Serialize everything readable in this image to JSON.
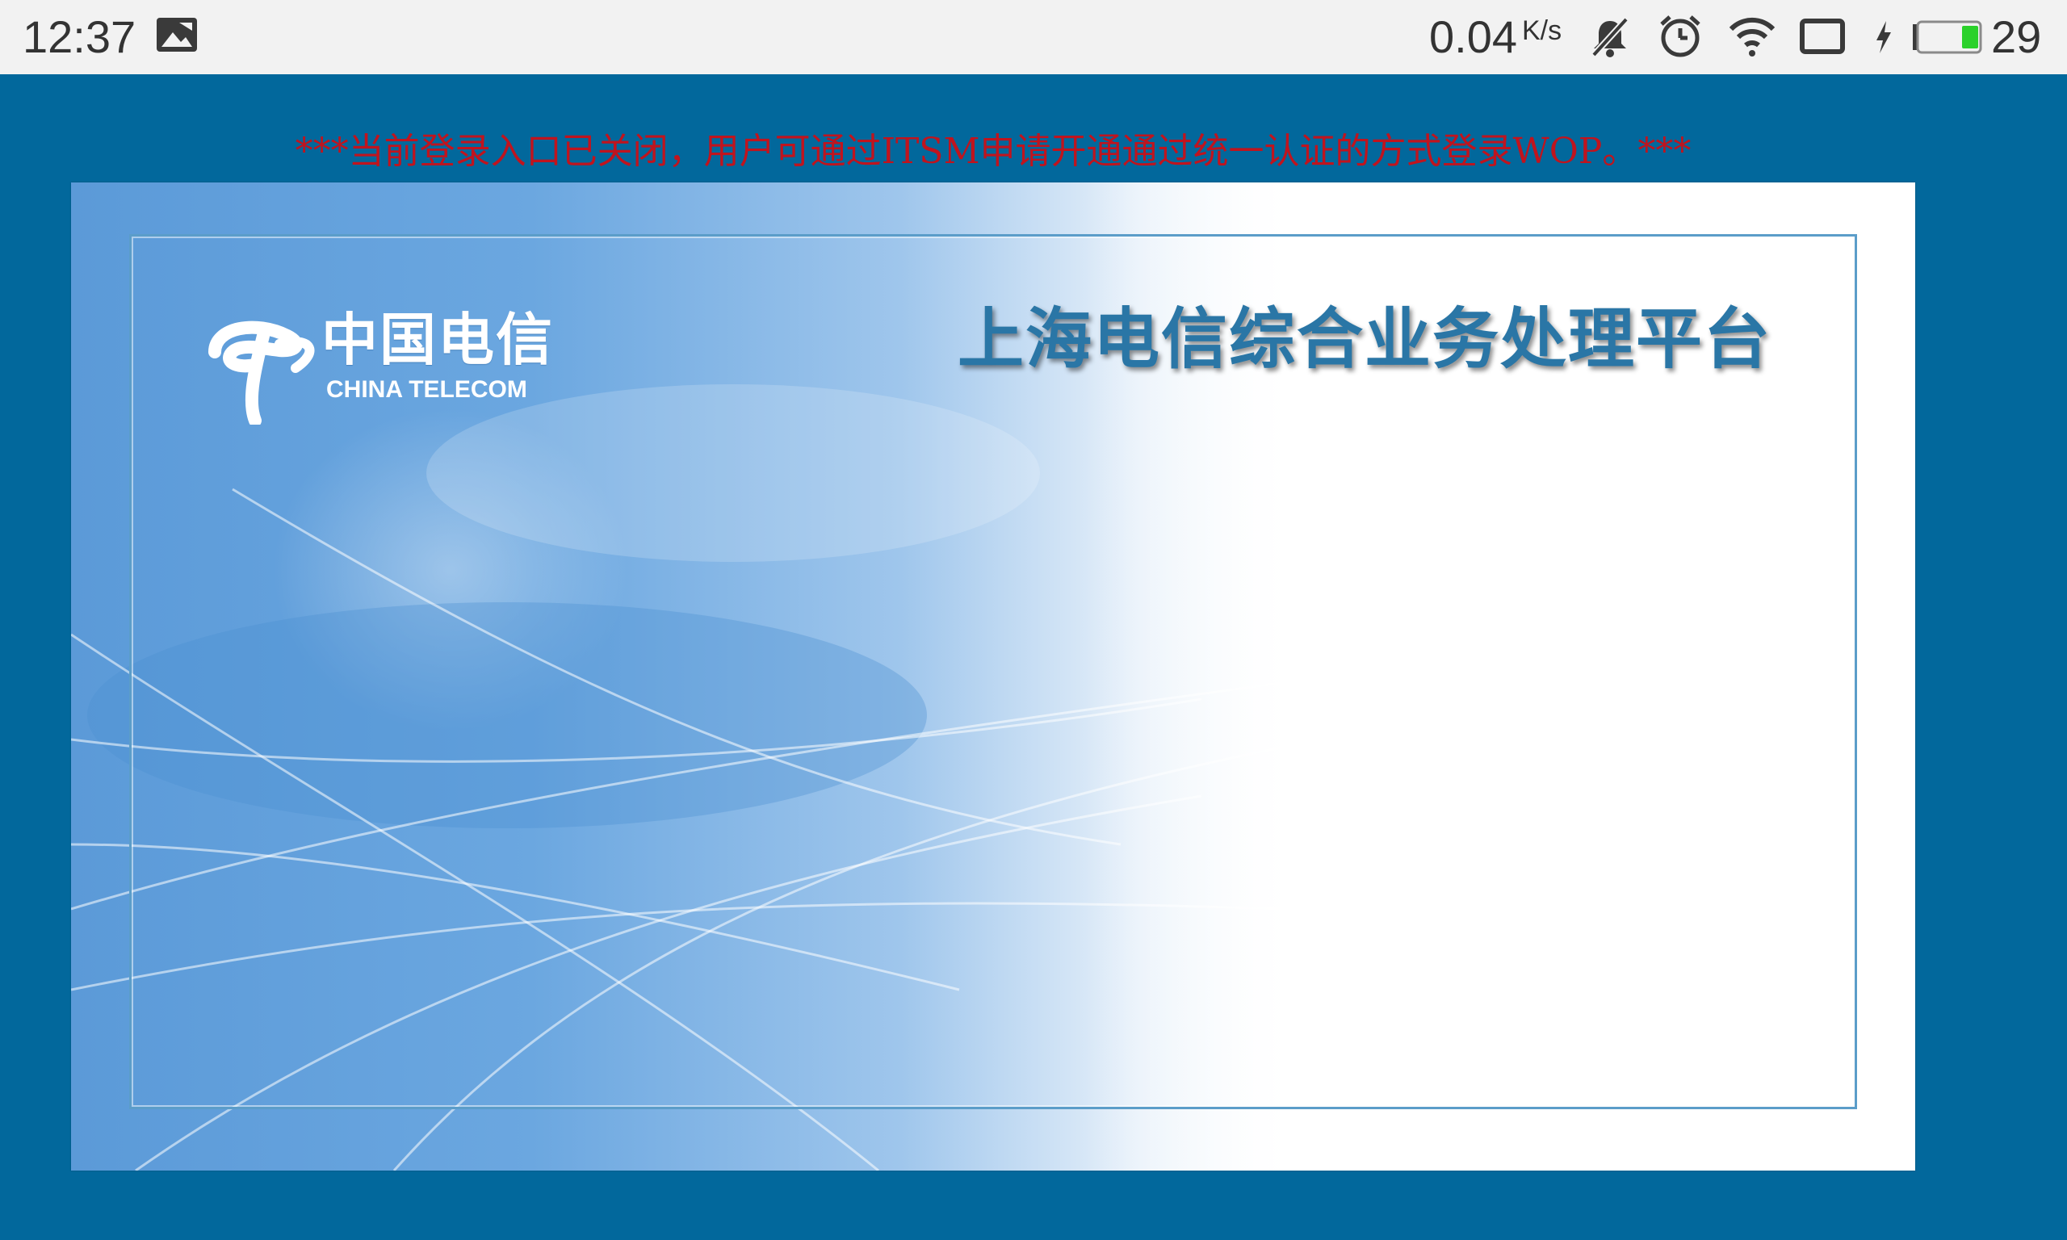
{
  "status_bar": {
    "time": "12:37",
    "net_speed_value": "0.04",
    "net_speed_unit": "K/s",
    "battery_level": "29",
    "icons": [
      "image-notification-icon",
      "mute-icon",
      "alarm-icon",
      "wifi-icon",
      "screen-rotation-icon",
      "charging-icon",
      "battery-icon"
    ],
    "battery_fill_color": "#2bd12b"
  },
  "notice": {
    "text": "***当前登录入口已关闭，用户可通过ITSM申请开通通过统一认证的方式登录WOP。***",
    "color": "#c0141e"
  },
  "brand": {
    "logo_cn": "中国电信",
    "logo_en": "CHINA TELECOM"
  },
  "page": {
    "title": "上海电信综合业务处理平台",
    "background_color": "#02689c"
  }
}
